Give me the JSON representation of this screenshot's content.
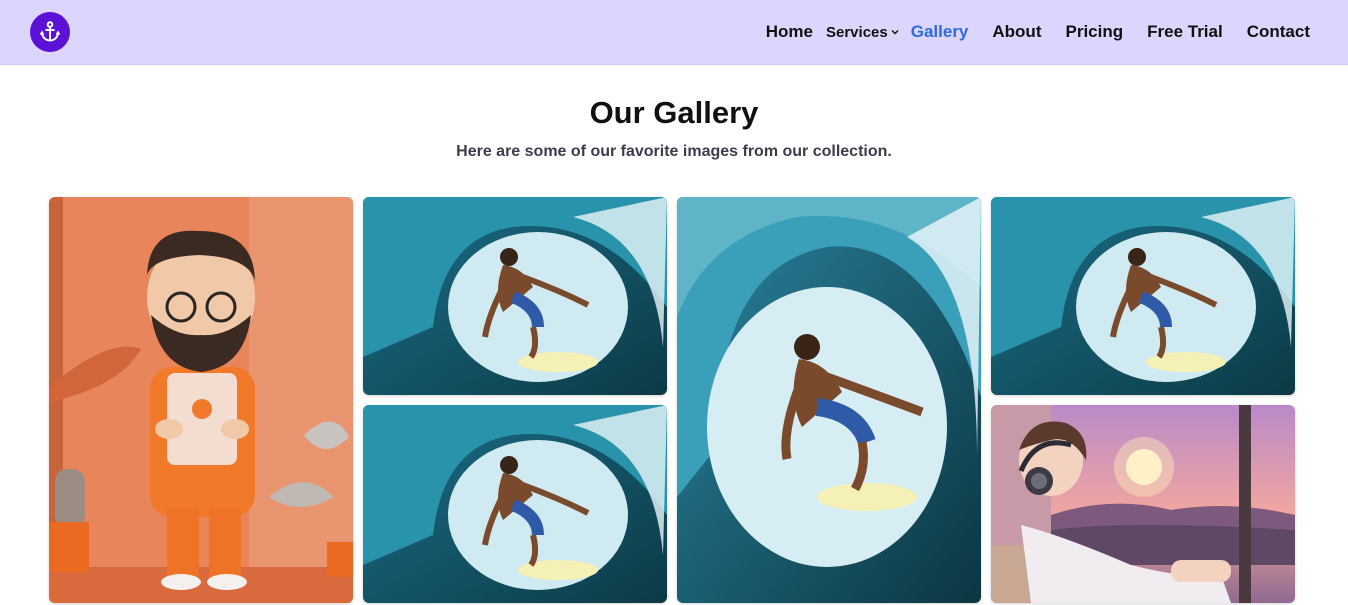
{
  "nav": {
    "items": [
      {
        "label": "Home"
      },
      {
        "label": "Services"
      },
      {
        "label": "Gallery"
      },
      {
        "label": "About"
      },
      {
        "label": "Pricing"
      },
      {
        "label": "Free Trial"
      },
      {
        "label": "Contact"
      }
    ],
    "active": "Gallery",
    "services_icon": "chevron-down-icon"
  },
  "logo": {
    "icon": "anchor-icon",
    "color": "#5b12d6"
  },
  "header": {
    "background": "#dcd6fe",
    "active_color": "#2f6bdc"
  },
  "gallery": {
    "title": "Our Gallery",
    "subtitle": "Here are some of our favorite images from our collection.",
    "images": [
      {
        "subject": "cartoon-man-with-tablet"
      },
      {
        "subject": "surfer-in-wave-barrel"
      },
      {
        "subject": "surfer-in-wave-barrel"
      },
      {
        "subject": "surfer-in-wave-barrel"
      },
      {
        "subject": "surfer-in-wave-barrel"
      },
      {
        "subject": "anime-boy-sunset"
      }
    ]
  }
}
